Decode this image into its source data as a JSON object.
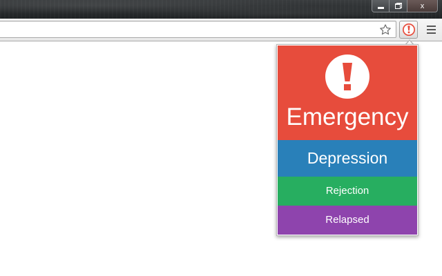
{
  "browser": {
    "address_value": "",
    "icons": {
      "bookmark": "star-icon",
      "extension": "exclamation-icon",
      "menu": "hamburger-menu-icon",
      "minimize": "minimize-icon",
      "restore": "restore-icon",
      "close": "close-icon"
    },
    "window_controls": {
      "close_glyph": "x"
    }
  },
  "popup": {
    "options": [
      {
        "label": "Emergency",
        "color": "#e74c3c"
      },
      {
        "label": "Depression",
        "color": "#2980b9"
      },
      {
        "label": "Rejection",
        "color": "#27ae60"
      },
      {
        "label": "Relapsed",
        "color": "#8e44ad"
      }
    ]
  }
}
